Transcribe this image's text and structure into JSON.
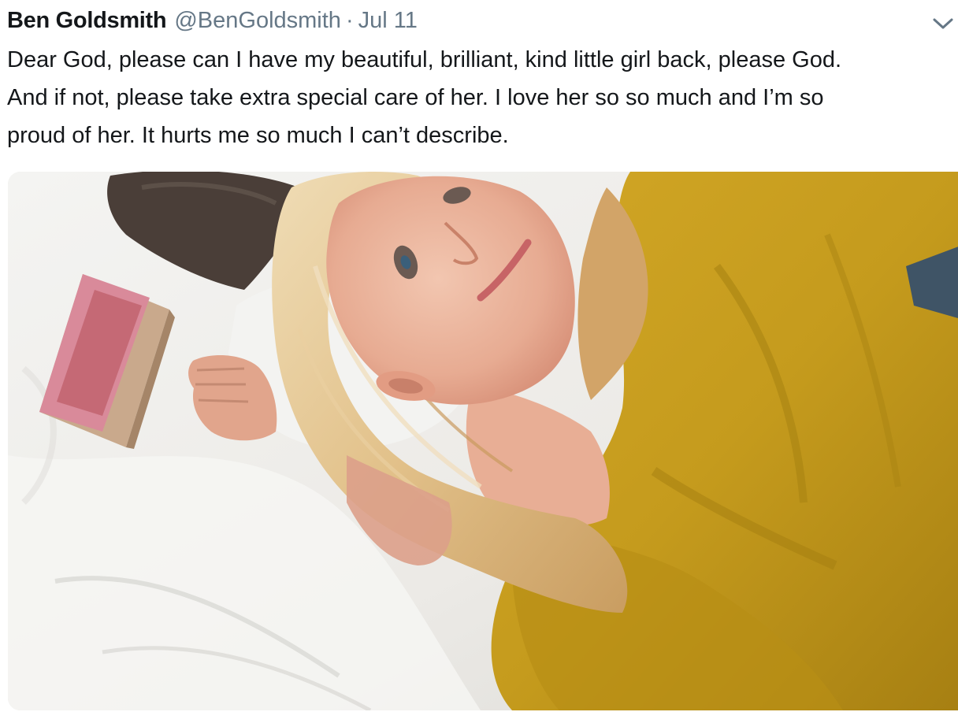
{
  "tweet": {
    "author_name": "Ben Goldsmith",
    "author_handle": "@BenGoldsmith",
    "separator": "·",
    "date": "Jul 11",
    "text_lines": [
      "Dear God, please can I have my beautiful, brilliant, kind little girl back, please God.",
      "And if not, please take extra special care of her. I love her so so much and I’m so",
      "proud of her. It hurts me so much I can’t describe."
    ],
    "menu_icon": "chevron-down-icon",
    "media_icon": "photo"
  },
  "colors": {
    "text": "#14171a",
    "secondary_text": "#657786",
    "background": "#ffffff",
    "sheet": "#efefec",
    "robe": "#c49a1c",
    "hair": "#e3c58f"
  }
}
